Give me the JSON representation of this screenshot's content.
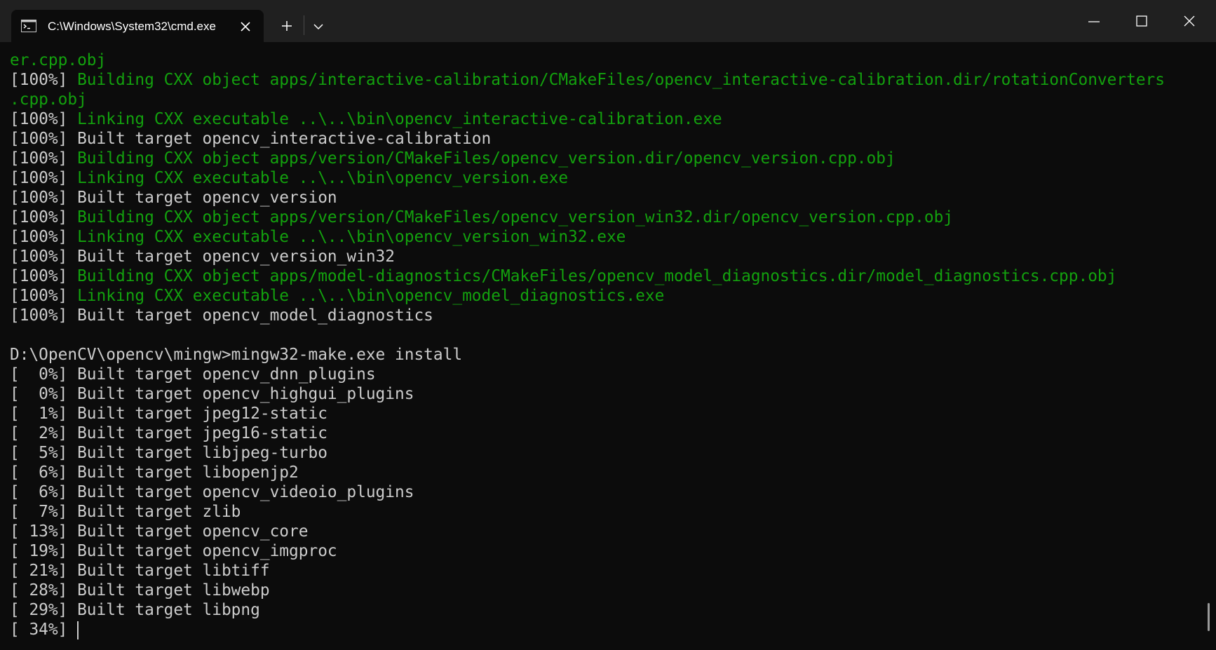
{
  "tab": {
    "title": "C:\\Windows\\System32\\cmd.exe",
    "icon": "cmd-prompt-icon"
  },
  "colors": {
    "terminal_bg": "#0c0c0c",
    "titlebar_bg": "#202020",
    "text": "#cccccc",
    "green": "#13a10e"
  },
  "terminal": {
    "lines": [
      {
        "p": "",
        "g": "er.cpp.obj"
      },
      {
        "p": "[100%] ",
        "g": "Building CXX object apps/interactive-calibration/CMakeFiles/opencv_interactive-calibration.dir/rotationConverters"
      },
      {
        "p": "",
        "g": ".cpp.obj"
      },
      {
        "p": "[100%] ",
        "g": "Linking CXX executable ..\\..\\bin\\opencv_interactive-calibration.exe"
      },
      {
        "p": "[100%] Built target opencv_interactive-calibration",
        "g": ""
      },
      {
        "p": "[100%] ",
        "g": "Building CXX object apps/version/CMakeFiles/opencv_version.dir/opencv_version.cpp.obj"
      },
      {
        "p": "[100%] ",
        "g": "Linking CXX executable ..\\..\\bin\\opencv_version.exe"
      },
      {
        "p": "[100%] Built target opencv_version",
        "g": ""
      },
      {
        "p": "[100%] ",
        "g": "Building CXX object apps/version/CMakeFiles/opencv_version_win32.dir/opencv_version.cpp.obj"
      },
      {
        "p": "[100%] ",
        "g": "Linking CXX executable ..\\..\\bin\\opencv_version_win32.exe"
      },
      {
        "p": "[100%] Built target opencv_version_win32",
        "g": ""
      },
      {
        "p": "[100%] ",
        "g": "Building CXX object apps/model-diagnostics/CMakeFiles/opencv_model_diagnostics.dir/model_diagnostics.cpp.obj"
      },
      {
        "p": "[100%] ",
        "g": "Linking CXX executable ..\\..\\bin\\opencv_model_diagnostics.exe"
      },
      {
        "p": "[100%] Built target opencv_model_diagnostics",
        "g": ""
      },
      {
        "p": "",
        "g": ""
      },
      {
        "p": "D:\\OpenCV\\opencv\\mingw>mingw32-make.exe install",
        "g": ""
      },
      {
        "p": "[  0%] Built target opencv_dnn_plugins",
        "g": ""
      },
      {
        "p": "[  0%] Built target opencv_highgui_plugins",
        "g": ""
      },
      {
        "p": "[  1%] Built target jpeg12-static",
        "g": ""
      },
      {
        "p": "[  2%] Built target jpeg16-static",
        "g": ""
      },
      {
        "p": "[  5%] Built target libjpeg-turbo",
        "g": ""
      },
      {
        "p": "[  6%] Built target libopenjp2",
        "g": ""
      },
      {
        "p": "[  6%] Built target opencv_videoio_plugins",
        "g": ""
      },
      {
        "p": "[  7%] Built target zlib",
        "g": ""
      },
      {
        "p": "[ 13%] Built target opencv_core",
        "g": ""
      },
      {
        "p": "[ 19%] Built target opencv_imgproc",
        "g": ""
      },
      {
        "p": "[ 21%] Built target libtiff",
        "g": ""
      },
      {
        "p": "[ 28%] Built target libwebp",
        "g": ""
      },
      {
        "p": "[ 29%] Built target libpng",
        "g": ""
      }
    ],
    "prompt_line": "[ 34%] "
  }
}
